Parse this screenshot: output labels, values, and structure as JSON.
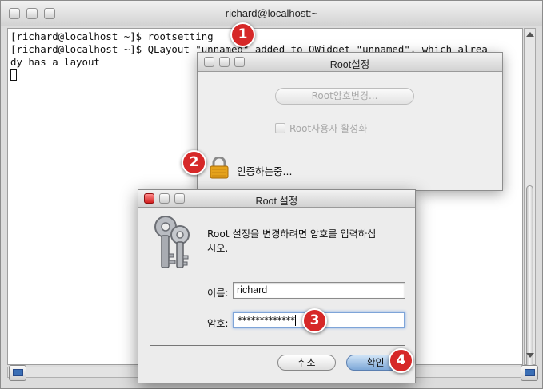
{
  "terminal": {
    "title": "richard@localhost:~",
    "lines": [
      "[richard@localhost ~]$ rootsetting",
      "[richard@localhost ~]$ QLayout \"unnamed\" added to QWidget \"unnamed\", which alrea",
      "dy has a layout"
    ]
  },
  "root_window": {
    "title": "Root설정",
    "change_password_button": "Root암호변경...",
    "enable_root_checkbox": "Root사용자 활성화",
    "auth_status": "인증하는중..."
  },
  "auth_dialog": {
    "title": "Root 설정",
    "prompt_line1": "Root 설정을 변경하려면 암호를 입력하십",
    "prompt_line2": "시오.",
    "name_label": "이름:",
    "name_value": "richard",
    "password_label": "암호:",
    "password_value": "*************",
    "cancel_button": "취소",
    "ok_button": "확인"
  },
  "markers": [
    "1",
    "2",
    "3",
    "4"
  ],
  "colors": {
    "marker": "#d62828",
    "default_button": "#7ea8d8",
    "focus_ring": "#7ea4d8"
  }
}
